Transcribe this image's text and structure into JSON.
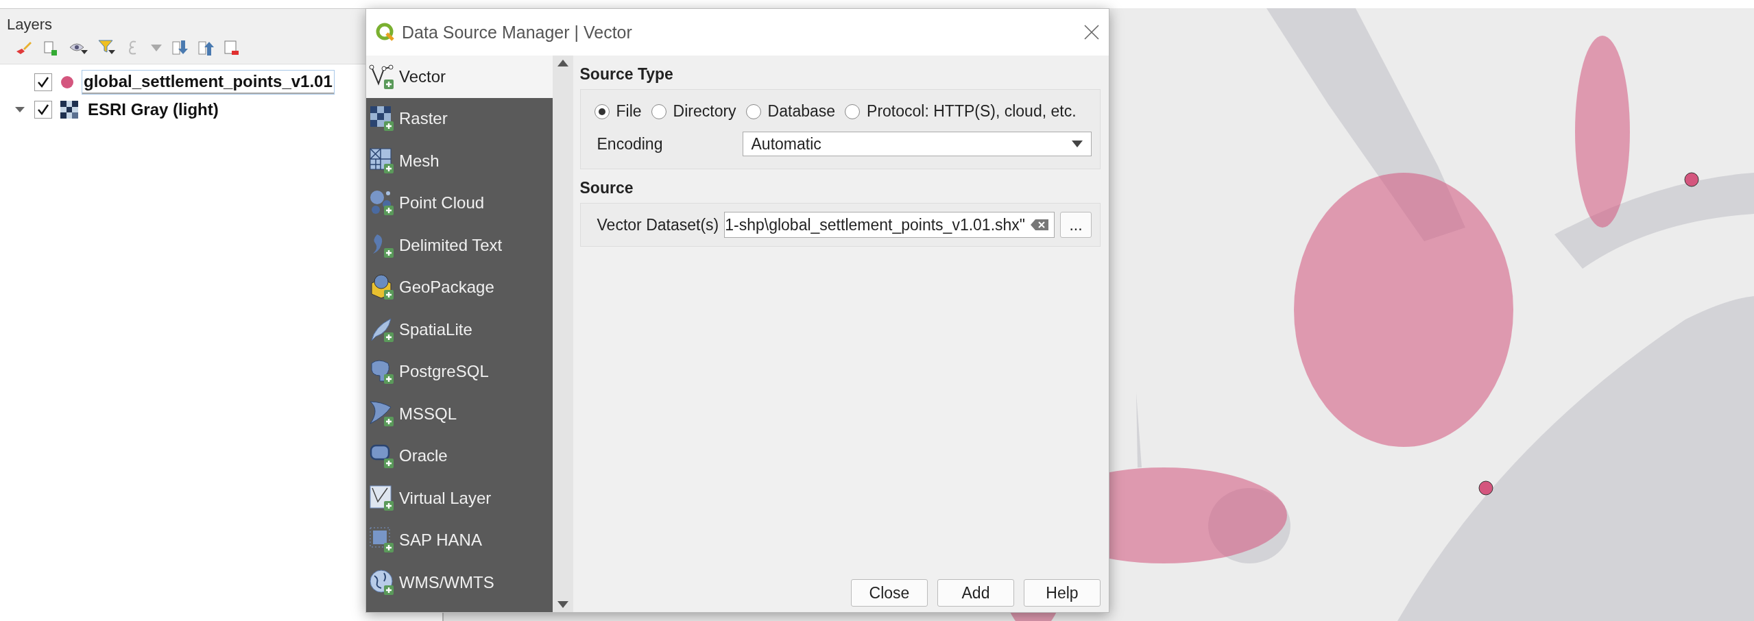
{
  "layers_panel": {
    "title": "Layers",
    "layers": [
      {
        "name": "global_settlement_points_v1.01",
        "checked": true,
        "selected": true,
        "kind": "point",
        "color": "#d4567e"
      },
      {
        "name": "ESRI Gray (light)",
        "checked": true,
        "selected": false,
        "kind": "raster",
        "expanded": true
      }
    ]
  },
  "dialog": {
    "title": "Data Source Manager | Vector",
    "sidebar": [
      {
        "label": "Vector",
        "kind": "vector",
        "selected": true
      },
      {
        "label": "Raster",
        "kind": "raster",
        "selected": false
      },
      {
        "label": "Mesh",
        "kind": "mesh",
        "selected": false
      },
      {
        "label": "Point Cloud",
        "kind": "pointcloud",
        "selected": false
      },
      {
        "label": "Delimited Text",
        "kind": "delimited",
        "selected": false
      },
      {
        "label": "GeoPackage",
        "kind": "geopackage",
        "selected": false
      },
      {
        "label": "SpatiaLite",
        "kind": "spatialite",
        "selected": false
      },
      {
        "label": "PostgreSQL",
        "kind": "postgres",
        "selected": false
      },
      {
        "label": "MSSQL",
        "kind": "mssql",
        "selected": false
      },
      {
        "label": "Oracle",
        "kind": "oracle",
        "selected": false
      },
      {
        "label": "Virtual Layer",
        "kind": "virtual",
        "selected": false
      },
      {
        "label": "SAP HANA",
        "kind": "hana",
        "selected": false
      },
      {
        "label": "WMS/WMTS",
        "kind": "wms",
        "selected": false
      }
    ],
    "source_type": {
      "heading": "Source Type",
      "options": [
        {
          "label": "File",
          "selected": true
        },
        {
          "label": "Directory",
          "selected": false
        },
        {
          "label": "Database",
          "selected": false
        },
        {
          "label": "Protocol: HTTP(S), cloud, etc.",
          "selected": false
        }
      ],
      "encoding_label": "Encoding",
      "encoding_value": "Automatic"
    },
    "source": {
      "heading": "Source",
      "dataset_label": "Vector Dataset(s)",
      "dataset_value": "1-shp\\global_settlement_points_v1.01.shx\"",
      "browse_button": "..."
    },
    "buttons": [
      "Close",
      "Add",
      "Help"
    ]
  }
}
